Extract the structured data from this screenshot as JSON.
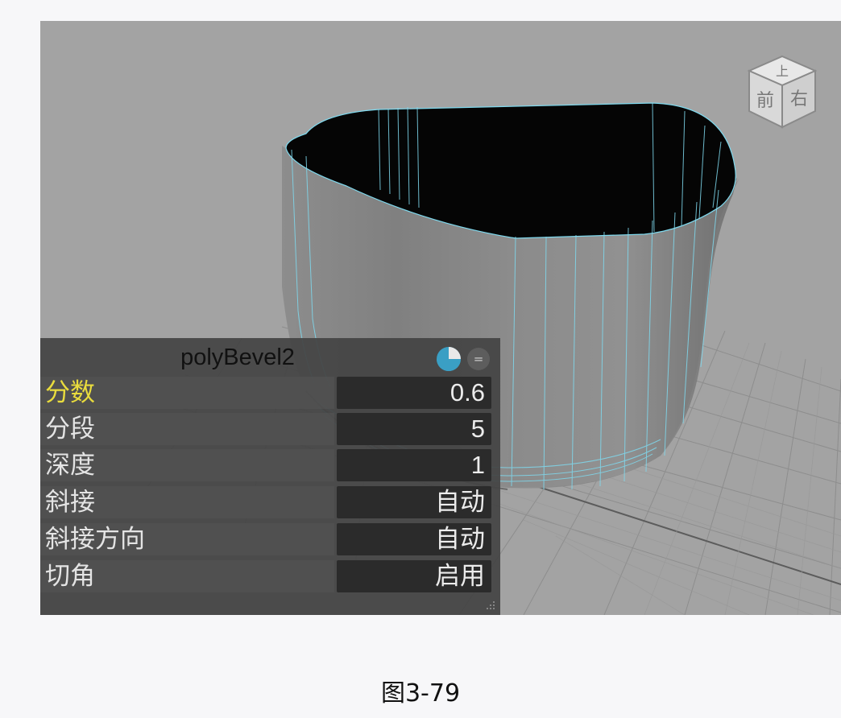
{
  "viewport": {
    "background": "#a3a3a3",
    "wire_color": "#7fd9ee",
    "viewcube": {
      "top": "上",
      "front": "前",
      "right": "右"
    }
  },
  "panel": {
    "title": "polyBevel2",
    "pie_icon": "pie-icon",
    "menu_icon": "=",
    "rows": [
      {
        "label": "分数",
        "value": "0.6",
        "active": true
      },
      {
        "label": "分段",
        "value": "5"
      },
      {
        "label": "深度",
        "value": "1"
      },
      {
        "label": "斜接",
        "value": "自动"
      },
      {
        "label": "斜接方向",
        "value": "自动"
      },
      {
        "label": "切角",
        "value": "启用"
      }
    ],
    "active_color": "#e9dc3d"
  },
  "caption": "图3-79"
}
